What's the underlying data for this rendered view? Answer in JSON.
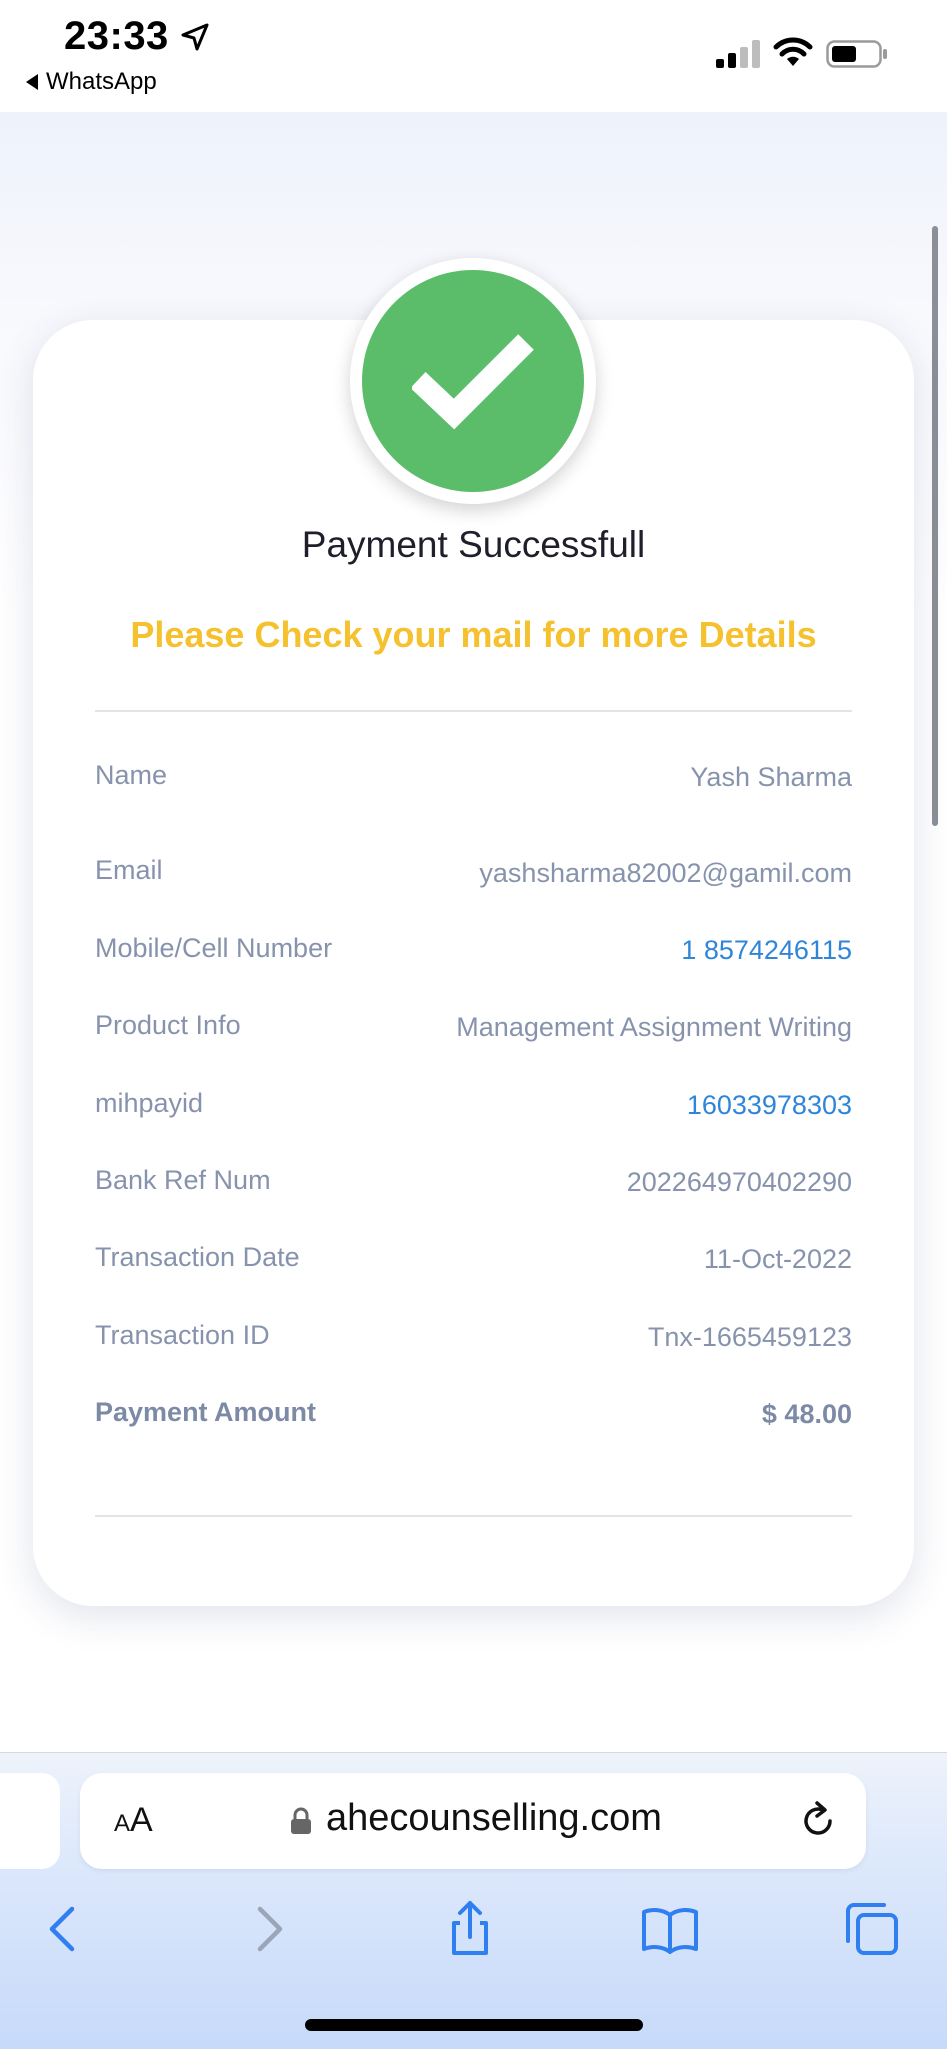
{
  "status_bar": {
    "time": "23:33",
    "back_app": "WhatsApp"
  },
  "payment": {
    "title": "Payment Successfull",
    "subtitle": "Please Check your mail for more Details",
    "rows": [
      {
        "label": "Name",
        "value": "Yash Sharma"
      },
      {
        "label": "Email",
        "value": "yashsharma82002@gamil.com"
      },
      {
        "label": "Mobile/Cell Number",
        "value": "1 8574246115"
      },
      {
        "label": "Product Info",
        "value": "Management Assignment Writing"
      },
      {
        "label": "mihpayid",
        "value": "16033978303"
      },
      {
        "label": "Bank Ref Num",
        "value": "202264970402290"
      },
      {
        "label": "Transaction Date",
        "value": "11-Oct-2022"
      },
      {
        "label": "Transaction ID",
        "value": "Tnx-1665459123"
      },
      {
        "label": "Payment Amount",
        "value": "$ 48.00"
      }
    ]
  },
  "browser": {
    "text_size_label_small": "A",
    "text_size_label_large": "A",
    "domain": "ahecounselling.com"
  },
  "colors": {
    "success_green": "#5bbd6a",
    "accent_yellow": "#f6c12f",
    "link_blue": "#2f86d8",
    "label_gray": "#8793ad"
  },
  "icons": [
    "location-arrow-icon",
    "cellular-signal-icon",
    "wifi-icon",
    "battery-icon",
    "checkmark-icon",
    "lock-icon",
    "reload-icon",
    "back-arrow-icon",
    "forward-arrow-icon",
    "share-icon",
    "bookmarks-icon",
    "tabs-icon"
  ]
}
